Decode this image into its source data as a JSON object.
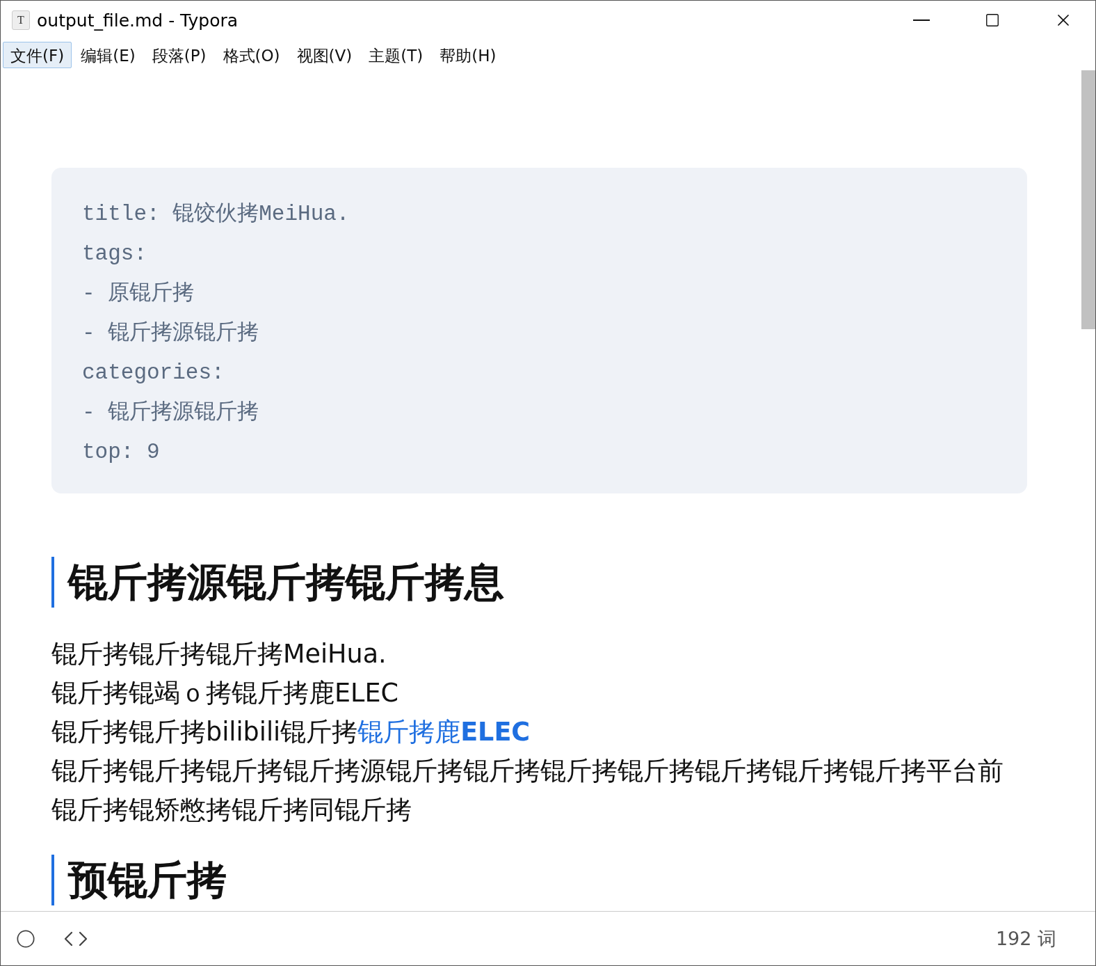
{
  "window": {
    "title": "output_file.md - Typora",
    "app_icon_letter": "T"
  },
  "menu": [
    {
      "label": "文件(F)",
      "selected": true
    },
    {
      "label": "编辑(E)",
      "selected": false
    },
    {
      "label": "段落(P)",
      "selected": false
    },
    {
      "label": "格式(O)",
      "selected": false
    },
    {
      "label": "视图(V)",
      "selected": false
    },
    {
      "label": "主题(T)",
      "selected": false
    },
    {
      "label": "帮助(H)",
      "selected": false
    }
  ],
  "front_matter": [
    "title: 锟饺伙拷MeiHua.",
    "tags:",
    "- 原锟斤拷",
    "- 锟斤拷源锟斤拷",
    "categories:",
    "- 锟斤拷源锟斤拷",
    "top: 9"
  ],
  "blocks": [
    {
      "kind": "heading",
      "text": "锟斤拷源锟斤拷锟斤拷息"
    },
    {
      "kind": "paragraph",
      "lines": [
        {
          "text": "锟斤拷锟斤拷锟斤拷MeiHua."
        },
        {
          "text": "锟斤拷锟竭ｏ拷锟斤拷鹿ELEC"
        },
        {
          "text": "锟斤拷锟斤拷bilibili锟斤拷",
          "link": "锟斤拷鹿**ELEC**"
        },
        {
          "text": "锟斤拷锟斤拷锟斤拷锟斤拷源锟斤拷锟斤拷锟斤拷锟斤拷锟斤拷锟斤拷锟斤拷平台前"
        },
        {
          "text": "锟斤拷锟矫憋拷锟斤拷同锟斤拷"
        }
      ]
    },
    {
      "kind": "heading",
      "text": "预锟斤拷"
    }
  ],
  "status_bar": {
    "word_count": "192 词"
  }
}
